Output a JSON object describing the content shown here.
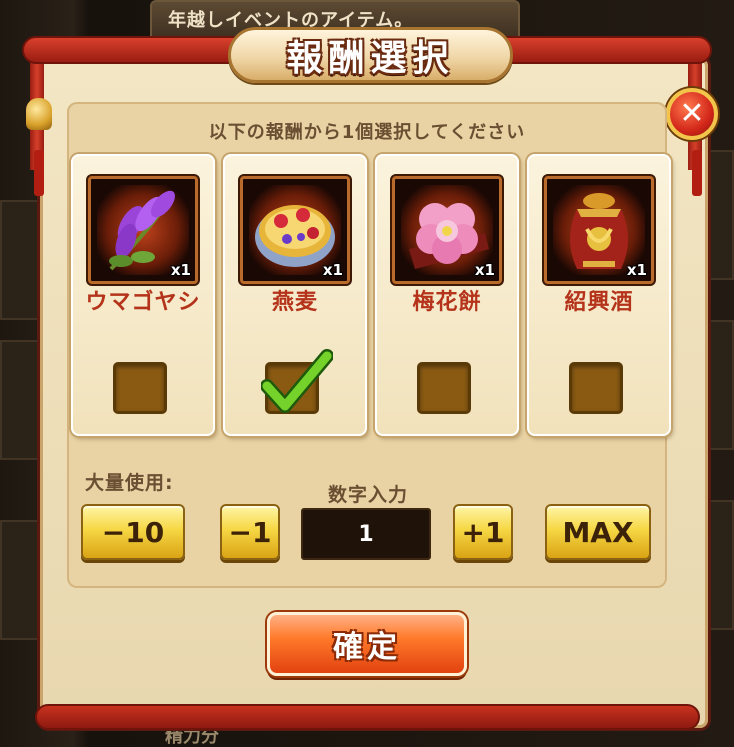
{
  "background": {
    "event_text": "年越しイベントのアイテム。",
    "bottom_text": "精力分"
  },
  "dialog": {
    "title": "報酬選択",
    "close_symbol": "✕",
    "instruction": "以下の報酬から1個選択してください",
    "rewards": [
      {
        "name": "ウマゴヤシ",
        "quantity": "x1",
        "icon": "alfalfa-icon",
        "selected": false
      },
      {
        "name": "燕麦",
        "quantity": "x1",
        "icon": "oats-bowl-icon",
        "selected": true
      },
      {
        "name": "梅花餅",
        "quantity": "x1",
        "icon": "plum-blossom-cake-icon",
        "selected": false
      },
      {
        "name": "紹興酒",
        "quantity": "x1",
        "icon": "shaoxing-wine-icon",
        "selected": false
      }
    ],
    "bulk_use_label": "大量使用:",
    "number_input_label": "数字入力",
    "buttons": {
      "minus10": "−10",
      "minus1": "−1",
      "plus1": "+1",
      "max": "MAX"
    },
    "quantity_value": "1",
    "confirm_label": "確定"
  },
  "colors": {
    "accent_red": "#c8321f",
    "gold": "#f6d744",
    "panel": "#f3e6c4",
    "name_red": "#b4331a"
  }
}
